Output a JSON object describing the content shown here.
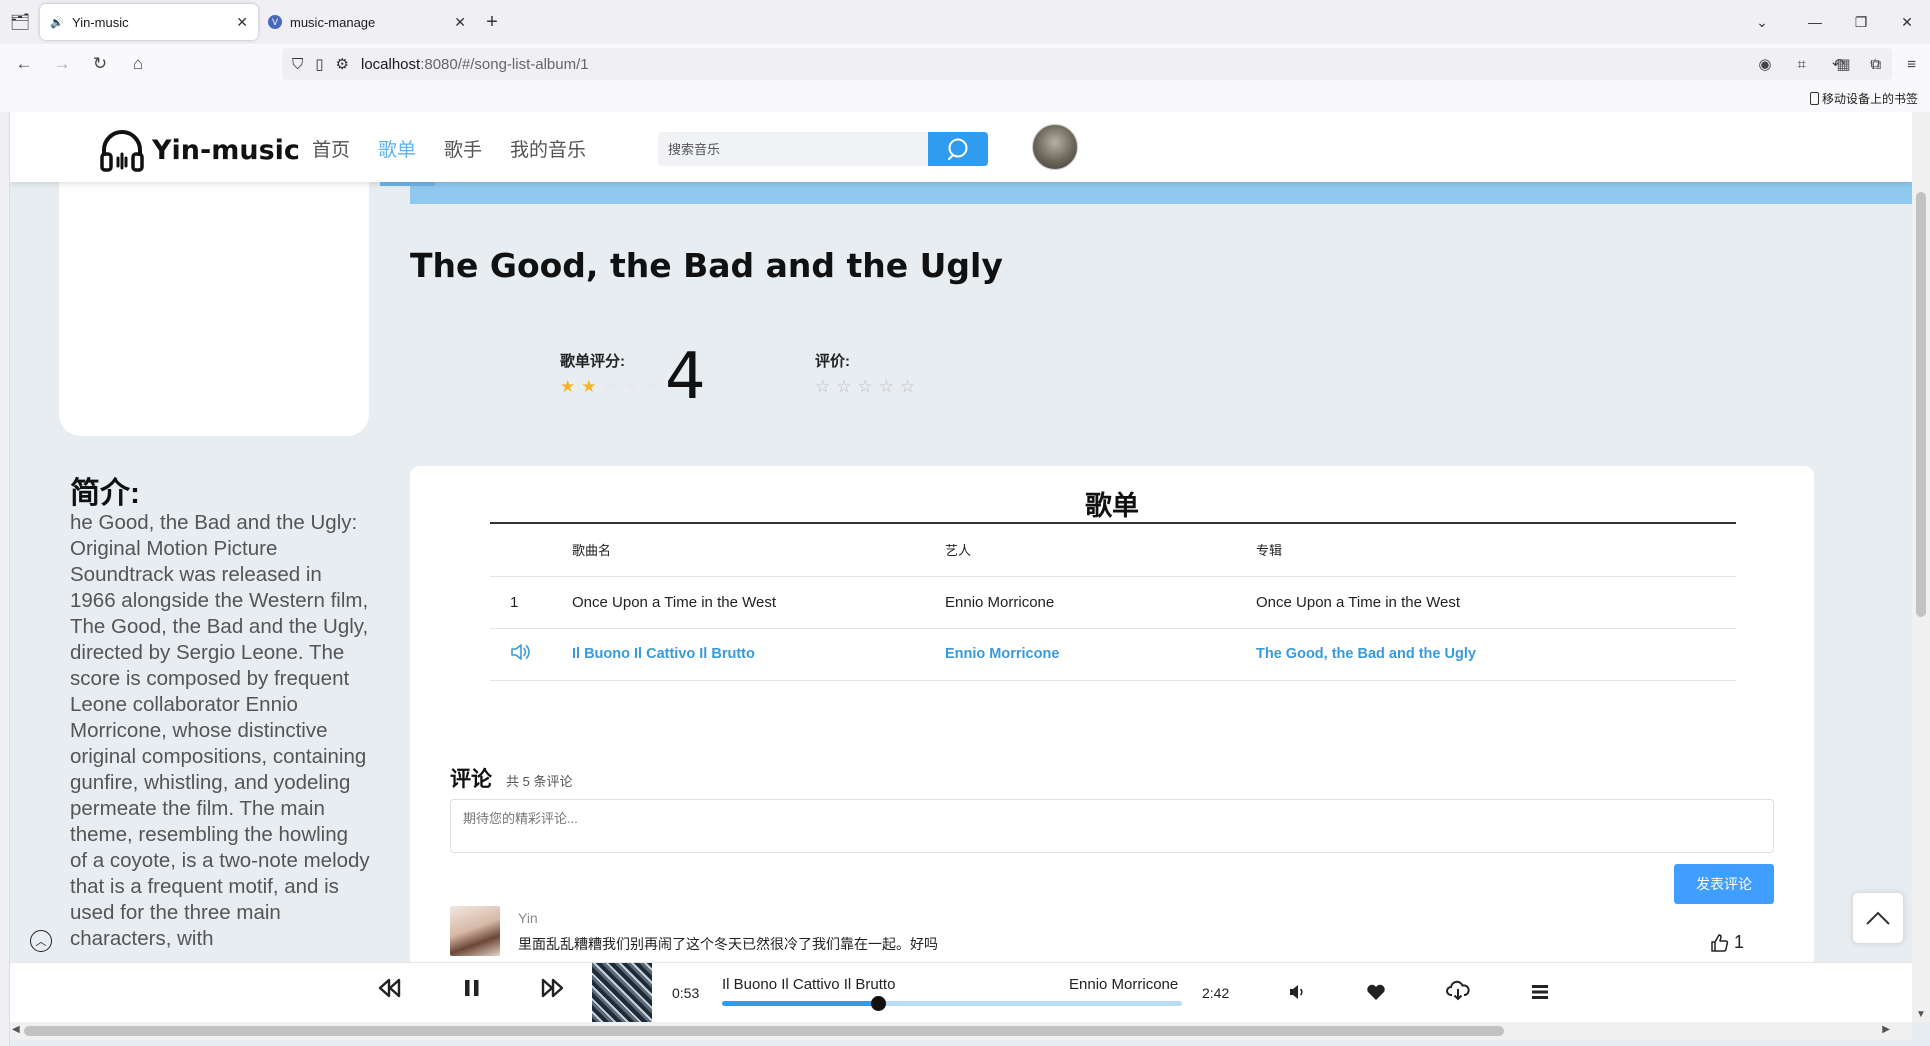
{
  "browser": {
    "tabs": [
      {
        "title": "Yin-music",
        "active": true
      },
      {
        "title": "music-manage",
        "active": false
      }
    ],
    "url_host": "localhost",
    "url_path": ":8080/#/song-list-album/1",
    "bookmark_mobile": "移动设备上的书签"
  },
  "header": {
    "logo_text": "Yin-music",
    "menu": [
      "首页",
      "歌单",
      "歌手",
      "我的音乐"
    ],
    "active_menu": "歌单",
    "search_placeholder": "搜索音乐"
  },
  "album": {
    "title": "The Good, the Bad and the Ugly",
    "rating_label": "歌单评分:",
    "rating_value": "4",
    "rating_stars": 2,
    "rating_stars_max": 5,
    "my_rating_label": "评价:",
    "intro_title": "简介:",
    "intro_text": "he Good, the Bad and the Ugly: Original Motion Picture Soundtrack was released in 1966 alongside the Western film, The Good, the Bad and the Ugly, directed by Sergio Leone. The score is composed by frequent Leone collaborator Ennio Morricone, whose distinctive original compositions, containing gunfire, whistling, and yodeling permeate the film. The main theme, resembling the howling of a coyote, is a two-note melody that is a frequent motif, and is used for the three main characters, with"
  },
  "songlist": {
    "title": "歌单",
    "headers": [
      "",
      "歌曲名",
      "艺人",
      "专辑"
    ],
    "rows": [
      {
        "index": "1",
        "name": "Once Upon a Time in the West",
        "artist": "Ennio Morricone",
        "album": "Once Upon a Time in the West",
        "playing": false
      },
      {
        "index": "",
        "name": "Il Buono Il Cattivo Il Brutto",
        "artist": "Ennio Morricone",
        "album": "The Good, the Bad and the Ugly",
        "playing": true
      }
    ]
  },
  "comments": {
    "title": "评论",
    "count_text": "共 5 条评论",
    "input_placeholder": "期待您的精彩评论...",
    "post_label": "发表评论",
    "items": [
      {
        "user": "Yin",
        "text": "里面乱乱糟糟我们别再闹了这个冬天已然很冷了我们靠在一起。好吗",
        "likes": "1"
      }
    ]
  },
  "player": {
    "current_time": "0:53",
    "song": "Il Buono Il Cattivo Il Brutto",
    "artist": "Ennio Morricone",
    "duration": "2:42",
    "progress": 0.34
  },
  "colors": {
    "accent": "#2f9cf0",
    "active_menu": "#5eb2f0",
    "playing_row": "#3a9ad9",
    "star_on": "#f3b52a"
  }
}
